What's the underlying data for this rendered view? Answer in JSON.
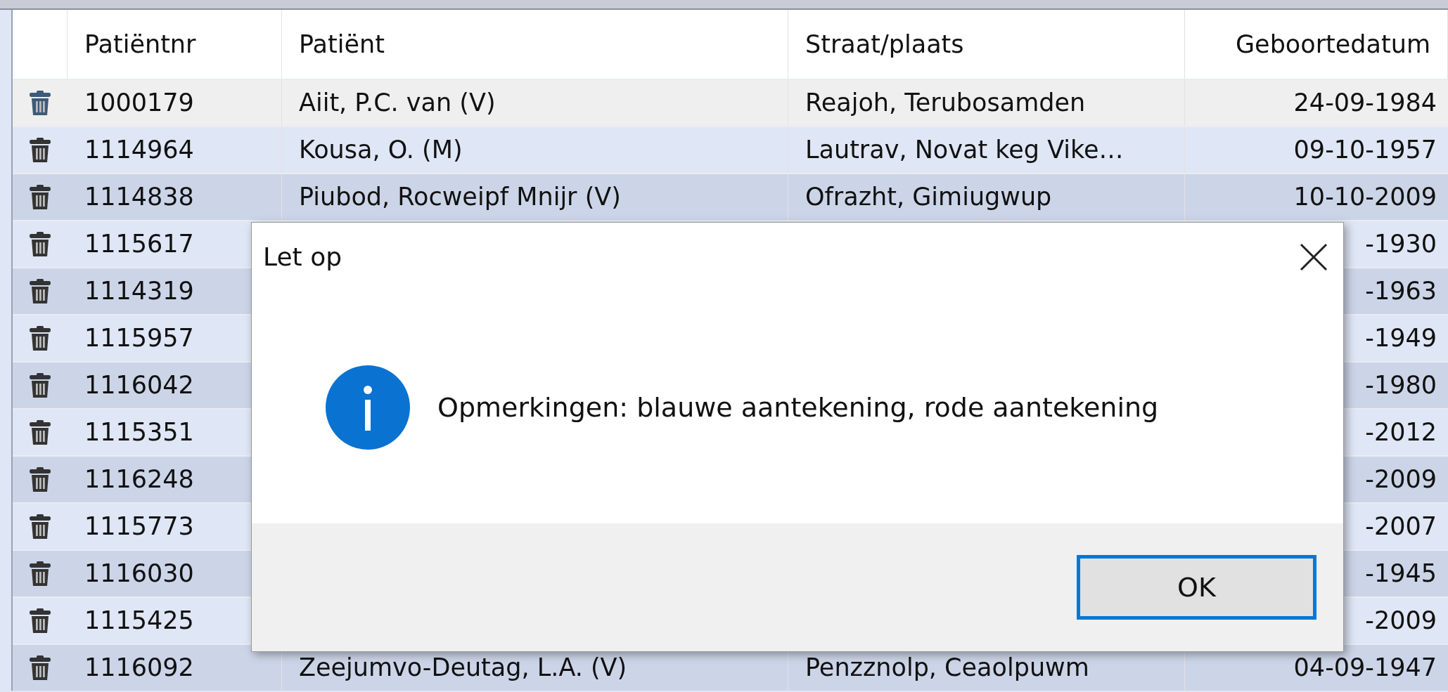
{
  "table": {
    "columns": [
      "Patiëntnr",
      "Patiënt",
      "Straat/plaats",
      "Geboortedatum"
    ],
    "rows": [
      {
        "nr": "1000179",
        "patient": "Aiit, P.C. van (V)",
        "street": "Reajoh, Terubosamden",
        "date": "24-09-1984",
        "selected": true
      },
      {
        "nr": "1114964",
        "patient": "Kousa, O. (M)",
        "street": "Lautrav, Novat keg Vike…",
        "date": "09-10-1957",
        "selected": false
      },
      {
        "nr": "1114838",
        "patient": "Piubod, Rocweipf Mnijr (V)",
        "street": "Ofrazht, Gimiugwup",
        "date": "10-10-2009",
        "selected": false
      },
      {
        "nr": "1115617",
        "date": "-1930",
        "selected": false
      },
      {
        "nr": "1114319",
        "date": "-1963",
        "selected": false
      },
      {
        "nr": "1115957",
        "date": "-1949",
        "selected": false
      },
      {
        "nr": "1116042",
        "date": "-1980",
        "selected": false
      },
      {
        "nr": "1115351",
        "date": "-2012",
        "selected": false
      },
      {
        "nr": "1116248",
        "date": "-2009",
        "selected": false
      },
      {
        "nr": "1115773",
        "date": "-2007",
        "selected": false
      },
      {
        "nr": "1116030",
        "date": "-1945",
        "selected": false
      },
      {
        "nr": "1115425",
        "date": "-2009",
        "selected": false
      },
      {
        "nr": "1116092",
        "patient": "Zeejumvo-Deutag, L.A. (V)",
        "street": "Penzznolp, Ceaolpuwm",
        "date": "04-09-1947",
        "selected": false
      }
    ]
  },
  "dialog": {
    "title": "Let op",
    "message": "Opmerkingen: blauwe aantekening, rode aantekening",
    "button": "OK"
  }
}
